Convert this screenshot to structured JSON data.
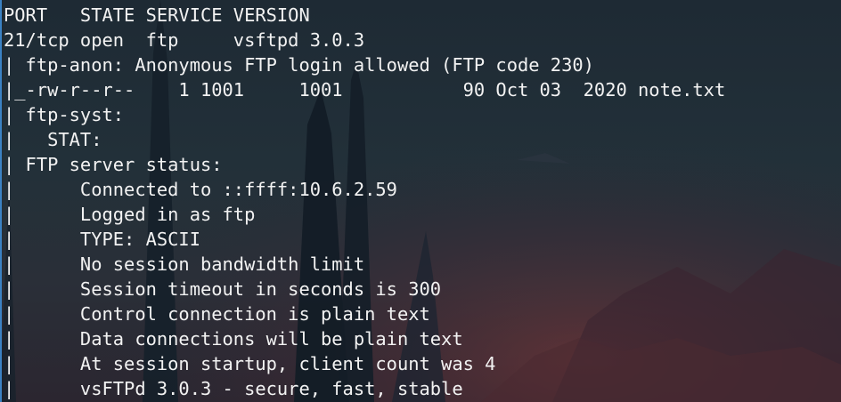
{
  "terminal": {
    "lines": [
      "PORT   STATE SERVICE VERSION",
      "21/tcp open  ftp     vsftpd 3.0.3",
      "| ftp-anon: Anonymous FTP login allowed (FTP code 230)",
      "|_-rw-r--r--    1 1001     1001           90 Oct 03  2020 note.txt",
      "| ftp-syst: ",
      "|   STAT: ",
      "| FTP server status:",
      "|      Connected to ::ffff:10.6.2.59",
      "|      Logged in as ftp",
      "|      TYPE: ASCII",
      "|      No session bandwidth limit",
      "|      Session timeout in seconds is 300",
      "|      Control connection is plain text",
      "|      Data connections will be plain text",
      "|      At session startup, client count was 4",
      "|      vsFTPd 3.0.3 - secure, fast, stable"
    ]
  },
  "colors": {
    "text": "#f2f2f2",
    "background": "#222e38",
    "cursor": "#3b82c4"
  }
}
